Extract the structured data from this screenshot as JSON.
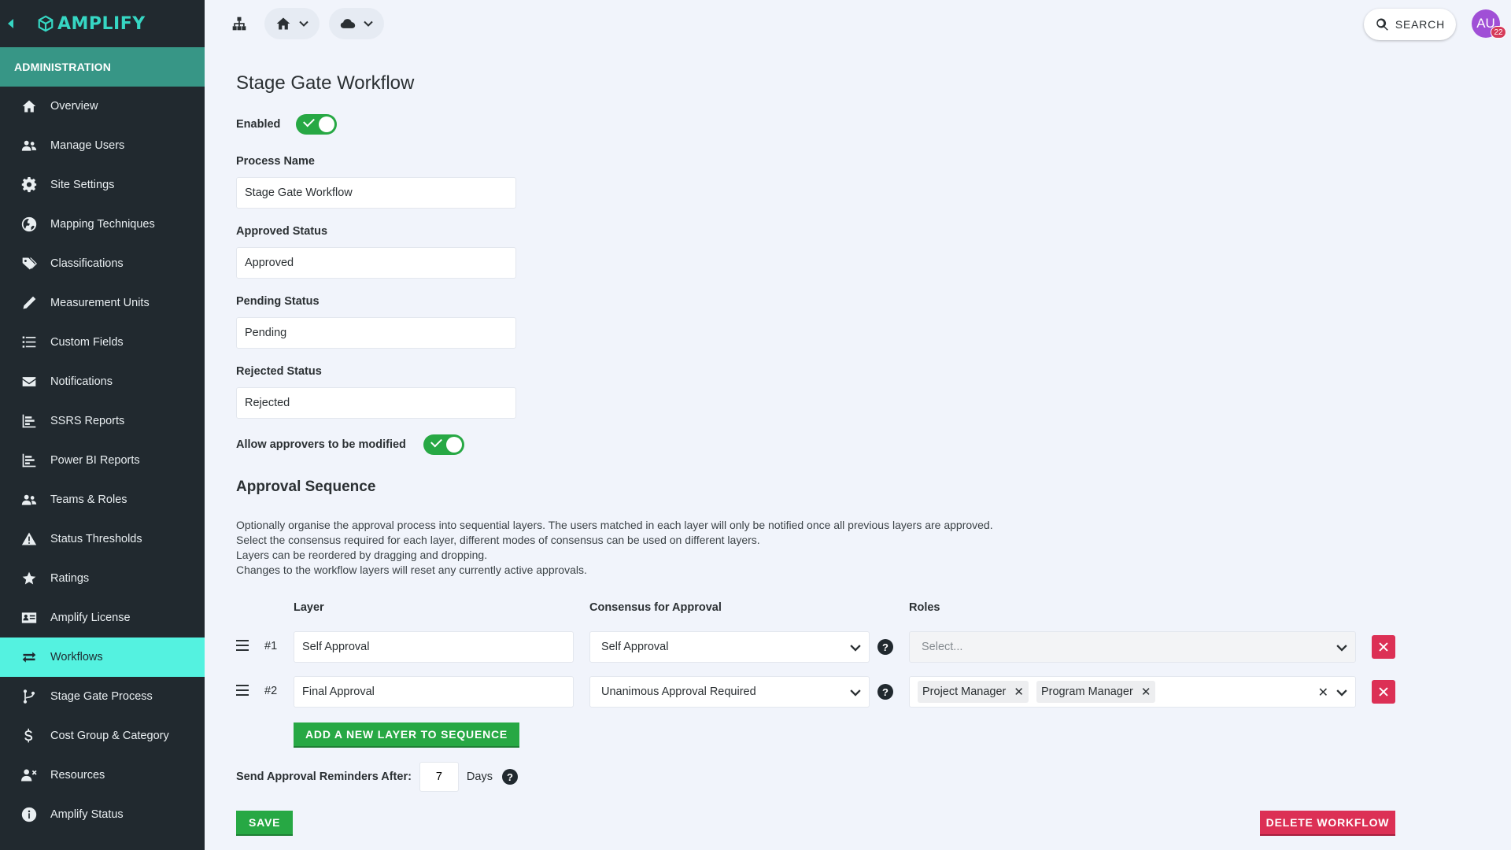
{
  "app": {
    "name": "AMPLIFY"
  },
  "sidebar": {
    "section": "Administration",
    "items": [
      {
        "label": "Overview",
        "icon": "home-icon"
      },
      {
        "label": "Manage Users",
        "icon": "users-icon"
      },
      {
        "label": "Site Settings",
        "icon": "gear-icon"
      },
      {
        "label": "Mapping Techniques",
        "icon": "globe-icon"
      },
      {
        "label": "Classifications",
        "icon": "tags-icon"
      },
      {
        "label": "Measurement Units",
        "icon": "ruler-icon"
      },
      {
        "label": "Custom Fields",
        "icon": "list-icon"
      },
      {
        "label": "Notifications",
        "icon": "envelope-icon"
      },
      {
        "label": "SSRS Reports",
        "icon": "bar-chart-icon"
      },
      {
        "label": "Power BI Reports",
        "icon": "bar-chart-icon"
      },
      {
        "label": "Teams & Roles",
        "icon": "users-icon"
      },
      {
        "label": "Status Thresholds",
        "icon": "warning-icon"
      },
      {
        "label": "Ratings",
        "icon": "star-icon"
      },
      {
        "label": "Amplify License",
        "icon": "id-card-icon"
      },
      {
        "label": "Workflows",
        "icon": "arrows-exchange-icon",
        "active": true
      },
      {
        "label": "Stage Gate Process",
        "icon": "branch-icon"
      },
      {
        "label": "Cost Group & Category",
        "icon": "dollar-icon"
      },
      {
        "label": "Resources",
        "icon": "user-remove-icon"
      },
      {
        "label": "Amplify Status",
        "icon": "info-icon"
      }
    ]
  },
  "topbar": {
    "search_label": "SEARCH",
    "avatar_initials": "AU",
    "notification_count": "22"
  },
  "form": {
    "title": "Stage Gate Workflow",
    "enabled_label": "Enabled",
    "enabled": true,
    "process_name_label": "Process Name",
    "process_name_value": "Stage Gate Workflow",
    "approved_status_label": "Approved Status",
    "approved_status_value": "Approved",
    "pending_status_label": "Pending Status",
    "pending_status_value": "Pending",
    "rejected_status_label": "Rejected Status",
    "rejected_status_value": "Rejected",
    "allow_modify_label": "Allow approvers to be modified",
    "allow_modify": true
  },
  "sequence": {
    "title": "Approval Sequence",
    "description": [
      "Optionally organise the approval process into sequential layers. The users matched in each layer will only be notified once all previous layers are approved.",
      "Select the consensus required for each layer, different modes of consensus can be used on different layers.",
      "Layers can be reordered by dragging and dropping.",
      "Changes to the workflow layers will reset any currently active approvals."
    ],
    "columns": {
      "layer": "Layer",
      "consensus": "Consensus for Approval",
      "roles": "Roles"
    },
    "rows": [
      {
        "num": "#1",
        "layer": "Self Approval",
        "consensus": "Self Approval",
        "roles_placeholder": "Select...",
        "roles": []
      },
      {
        "num": "#2",
        "layer": "Final Approval",
        "consensus": "Unanimous Approval Required",
        "roles": [
          "Project Manager",
          "Program Manager"
        ]
      }
    ],
    "add_button": "ADD A NEW LAYER TO SEQUENCE",
    "reminder_label": "Send Approval Reminders After:",
    "reminder_value": "7",
    "reminder_unit": "Days"
  },
  "actions": {
    "save": "SAVE",
    "delete": "DELETE WORKFLOW"
  },
  "colors": {
    "accent": "#36d6c3",
    "active_nav": "#54f2e0",
    "success": "#27a844",
    "danger": "#dc3055",
    "sidebar_bg": "#21292f"
  }
}
